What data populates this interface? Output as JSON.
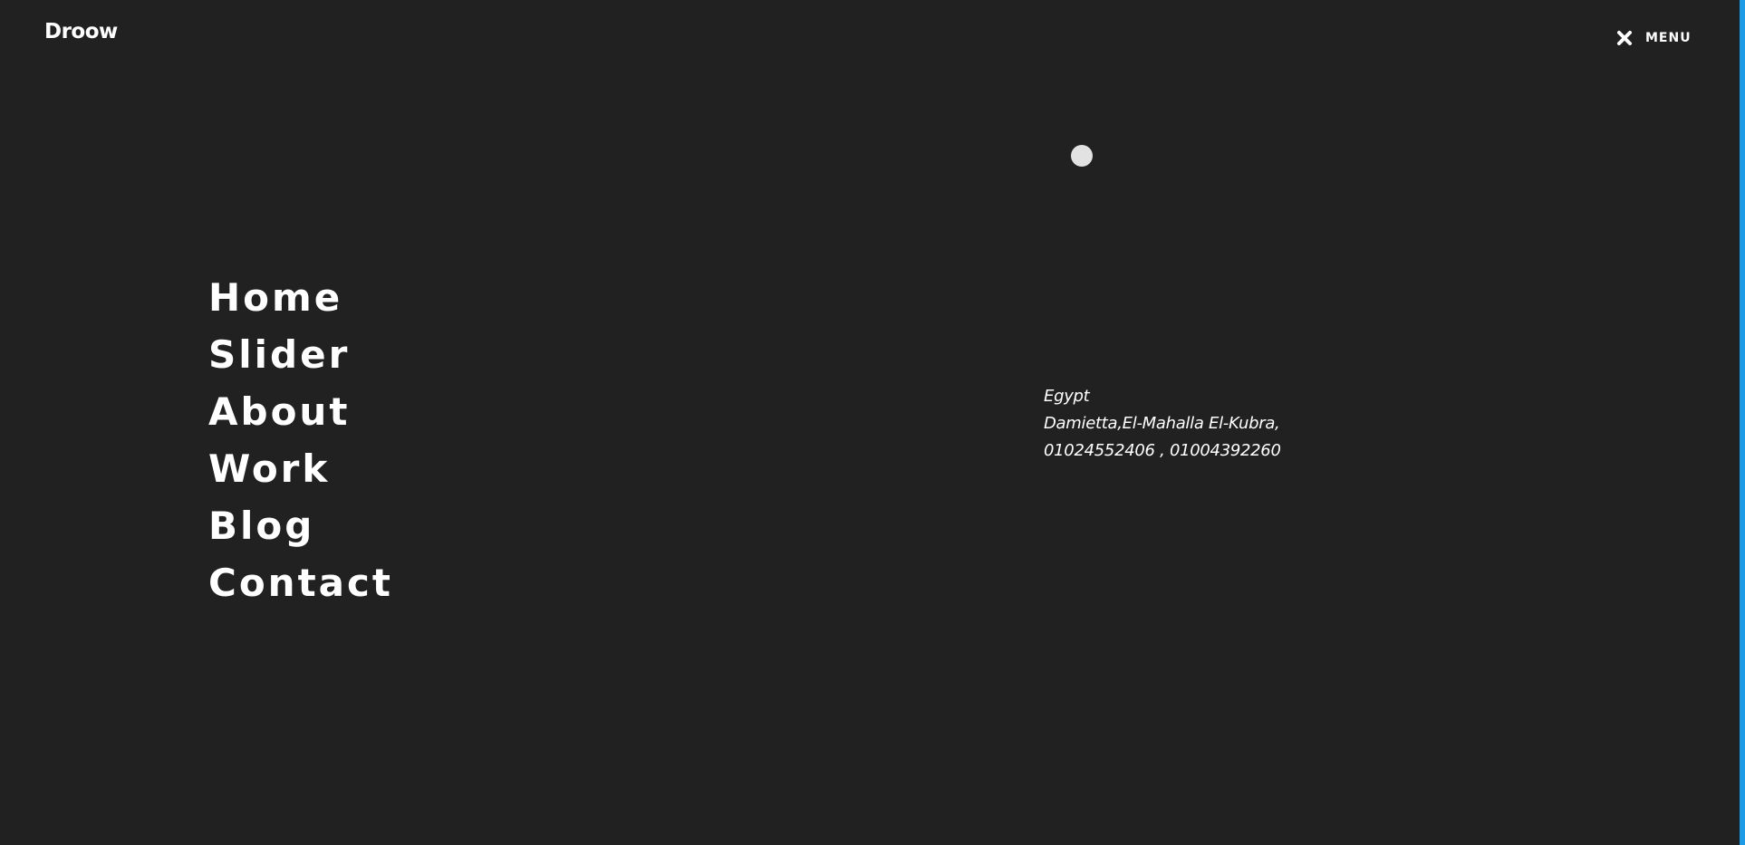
{
  "header": {
    "logo_text": "Droow",
    "menu_label": "MENU",
    "menu_icon": "close-icon"
  },
  "nav": {
    "items": [
      {
        "label": "Home"
      },
      {
        "label": "Slider"
      },
      {
        "label": "About"
      },
      {
        "label": "Work"
      },
      {
        "label": "Blog"
      },
      {
        "label": "Contact"
      }
    ]
  },
  "contact": {
    "country": "Egypt",
    "address": "Damietta,El-Mahalla El-Kubra,",
    "phones": "01024552406 , 01004392260"
  },
  "colors": {
    "background": "#212121",
    "text": "#ffffff",
    "cursor_dot": "#e2e2e2",
    "edge_accent": "#1e9be6"
  }
}
